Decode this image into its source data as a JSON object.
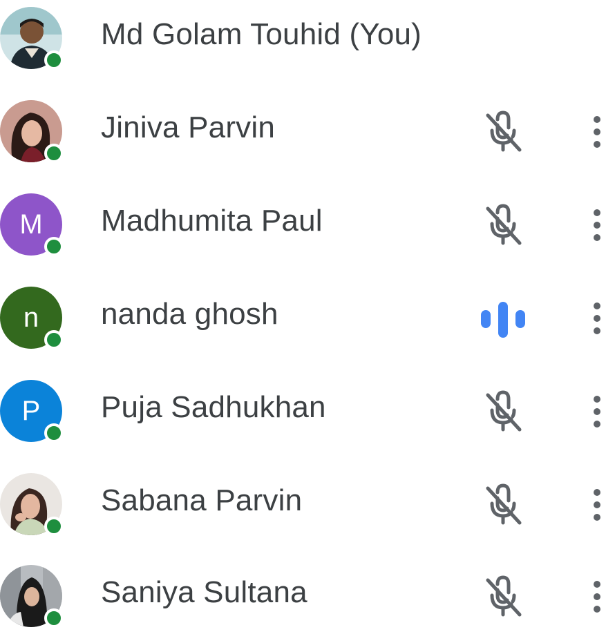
{
  "colors": {
    "presence": "#1e8e3e",
    "name_text": "#3c4043",
    "icon_gray": "#5f6368",
    "speaking_blue": "#4285f4"
  },
  "participants": [
    {
      "name": "Md Golam Touhid (You)",
      "avatar": "photo",
      "mic": "none",
      "presence": "online"
    },
    {
      "name": "Jiniva Parvin",
      "avatar": "photo",
      "mic": "muted",
      "presence": "online"
    },
    {
      "name": "Madhumita Paul",
      "avatar": "letter",
      "initial": "M",
      "avatar_color": "#8e55c9",
      "mic": "muted",
      "presence": "online"
    },
    {
      "name": "nanda ghosh",
      "avatar": "letter",
      "initial": "n",
      "avatar_color": "#33691e",
      "mic": "speaking",
      "presence": "online"
    },
    {
      "name": "Puja Sadhukhan",
      "avatar": "letter",
      "initial": "P",
      "avatar_color": "#0b83d9",
      "mic": "muted",
      "presence": "online"
    },
    {
      "name": "Sabana Parvin",
      "avatar": "photo",
      "mic": "muted",
      "presence": "online"
    },
    {
      "name": "Saniya Sultana",
      "avatar": "photo",
      "mic": "muted",
      "presence": "online"
    }
  ],
  "icons": {
    "muted": "mic-off-icon",
    "speaking": "audio-level-icon",
    "more": "more-vert-icon",
    "presence": "online-status-dot"
  }
}
